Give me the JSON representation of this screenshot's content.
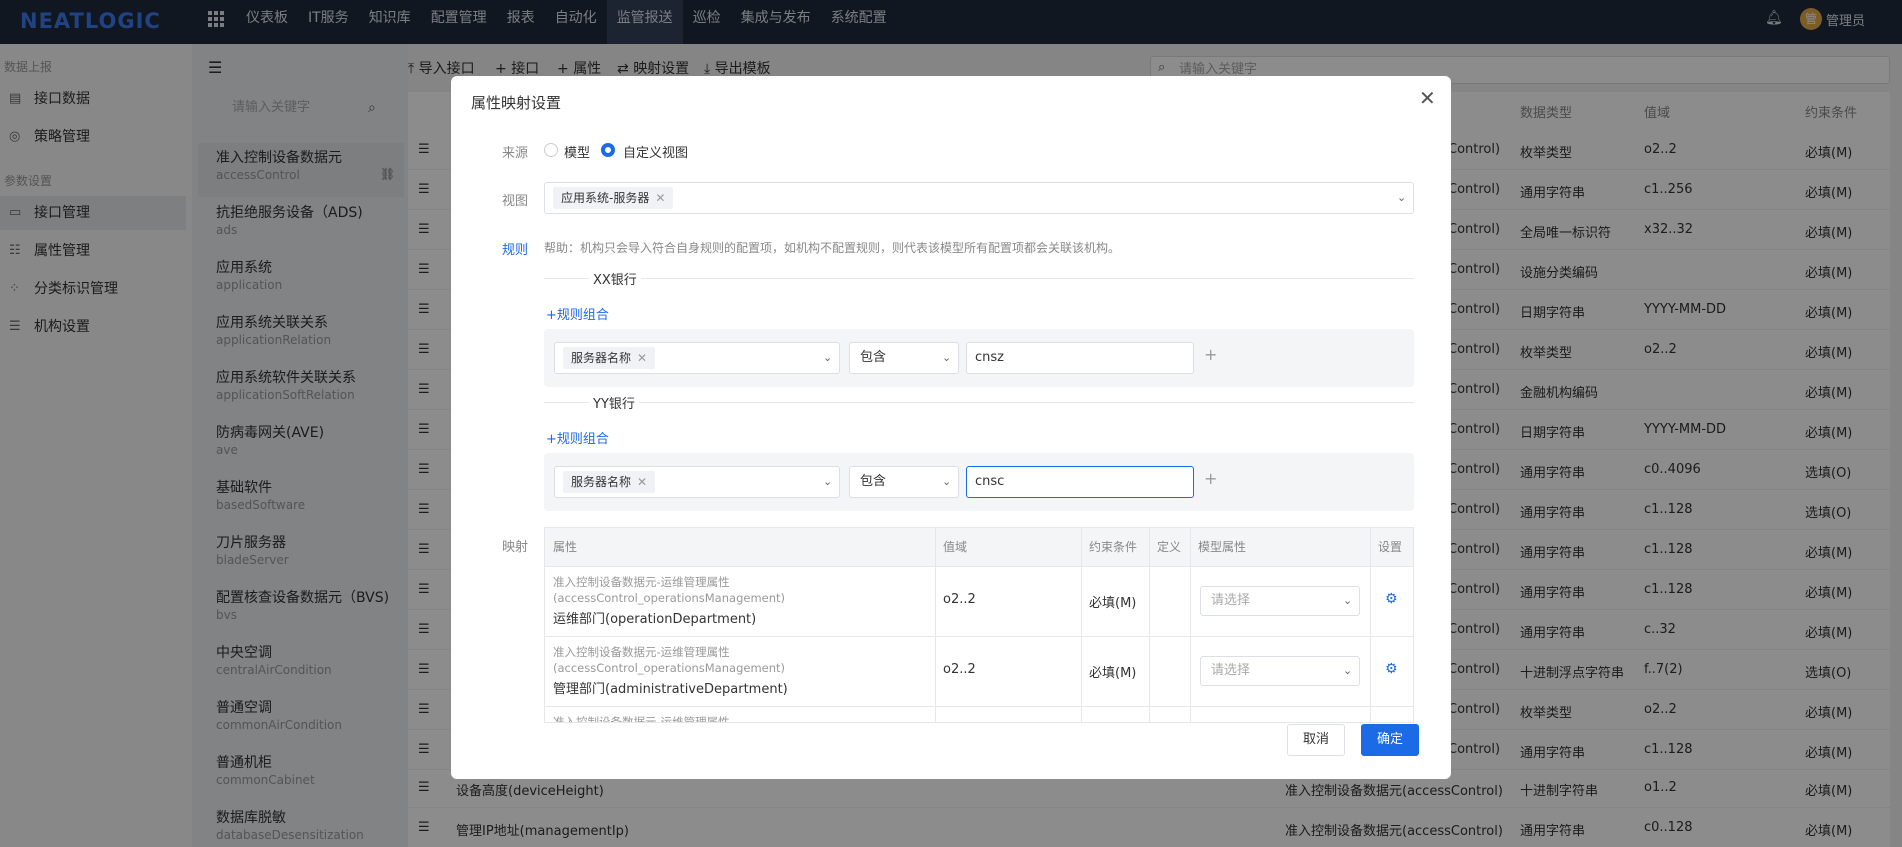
{
  "topbar": {
    "logo": "NEATLOGIC",
    "nav": [
      "仪表板",
      "IT服务",
      "知识库",
      "配置管理",
      "报表",
      "自动化",
      "监管报送",
      "巡检",
      "集成与发布",
      "系统配置"
    ],
    "active_nav": "监管报送",
    "avatar_text": "管",
    "user": "管理员",
    "bell_icon": "bell-icon"
  },
  "sidebar": {
    "section1": "数据上报",
    "section2": "参数设置",
    "items": [
      {
        "label": "接口数据",
        "icon": "data-icon"
      },
      {
        "label": "策略管理",
        "icon": "policy-icon"
      },
      {
        "label": "接口管理",
        "icon": "interface-icon"
      },
      {
        "label": "属性管理",
        "icon": "attribute-icon"
      },
      {
        "label": "分类标识管理",
        "icon": "category-icon"
      },
      {
        "label": "机构设置",
        "icon": "org-icon"
      }
    ]
  },
  "list": {
    "search_placeholder": "请输入关键字",
    "items": [
      {
        "title": "准入控制设备数据元",
        "sub": "accessControl"
      },
      {
        "title": "抗拒绝服务设备（ADS)",
        "sub": "ads"
      },
      {
        "title": "应用系统",
        "sub": "application"
      },
      {
        "title": "应用系统关联关系",
        "sub": "applicationRelation"
      },
      {
        "title": "应用系统软件关联关系",
        "sub": "applicationSoftRelation"
      },
      {
        "title": "防病毒网关(AVE)",
        "sub": "ave"
      },
      {
        "title": "基础软件",
        "sub": "basedSoftware"
      },
      {
        "title": "刀片服务器",
        "sub": "bladeServer"
      },
      {
        "title": "配置核查设备数据元（BVS)",
        "sub": "bvs"
      },
      {
        "title": "中央空调",
        "sub": "centralAirCondition"
      },
      {
        "title": "普通空调",
        "sub": "commonAirCondition"
      },
      {
        "title": "普通机柜",
        "sub": "commonCabinet"
      },
      {
        "title": "数据库脱敏",
        "sub": "databaseDesensitization"
      }
    ]
  },
  "toolbar": {
    "import_interface": "导入接口",
    "interface": "接口",
    "attribute": "属性",
    "mapping": "映射设置",
    "export_template": "导出模板",
    "search_placeholder": "请输入关键字"
  },
  "bg_table": {
    "headers": {
      "type": "数据类型",
      "domain": "值域",
      "constraint": "约束条件"
    },
    "rows": [
      {
        "src": "Control)",
        "type": "枚举类型",
        "domain": "o2..2",
        "constraint": "必填(M)"
      },
      {
        "src": "Control)",
        "type": "通用字符串",
        "domain": "c1..256",
        "constraint": "必填(M)"
      },
      {
        "src": "Control)",
        "type": "全局唯一标识符",
        "domain": "x32..32",
        "constraint": "必填(M)"
      },
      {
        "src": "Control)",
        "type": "设施分类编码",
        "domain": "",
        "constraint": "必填(M)"
      },
      {
        "src": "Control)",
        "type": "日期字符串",
        "domain": "YYYY-MM-DD",
        "constraint": "必填(M)"
      },
      {
        "src": "Control)",
        "type": "枚举类型",
        "domain": "o2..2",
        "constraint": "必填(M)"
      },
      {
        "src": "Control)",
        "type": "金融机构编码",
        "domain": "",
        "constraint": "必填(M)"
      },
      {
        "src": "Control)",
        "type": "日期字符串",
        "domain": "YYYY-MM-DD",
        "constraint": "必填(M)"
      },
      {
        "src": "Control)",
        "type": "通用字符串",
        "domain": "c0..4096",
        "constraint": "选填(O)"
      },
      {
        "src": "Control)",
        "type": "通用字符串",
        "domain": "c1..128",
        "constraint": "选填(O)"
      },
      {
        "src": "Control)",
        "type": "通用字符串",
        "domain": "c1..128",
        "constraint": "必填(M)"
      },
      {
        "src": "Control)",
        "type": "通用字符串",
        "domain": "c1..128",
        "constraint": "必填(M)"
      },
      {
        "src": "Control)",
        "type": "通用字符串",
        "domain": "c..32",
        "constraint": "必填(M)"
      },
      {
        "src": "Control)",
        "type": "十进制浮点字符串",
        "domain": "f..7(2)",
        "constraint": "选填(O)"
      },
      {
        "src": "Control)",
        "type": "枚举类型",
        "domain": "o2..2",
        "constraint": "必填(M)"
      },
      {
        "src": "Control)",
        "type": "通用字符串",
        "domain": "c1..128",
        "constraint": "必填(M)"
      },
      {
        "name": "设备高度(deviceHeight)",
        "src": "准入控制设备数据元(accessControl)",
        "type": "十进制字符串",
        "domain": "o1..2",
        "constraint": "必填(M)"
      },
      {
        "name": "管理IP地址(managementIp)",
        "src": "准入控制设备数据元(accessControl)",
        "type": "通用字符串",
        "domain": "c0..128",
        "constraint": "必填(M)"
      }
    ]
  },
  "dialog": {
    "title": "属性映射设置",
    "source_label": "来源",
    "source_options": [
      "模型",
      "自定义视图"
    ],
    "source_selected": "自定义视图",
    "view_label": "视图",
    "view_tag": "应用系统-服务器",
    "rule_label": "规则",
    "help": "帮助：机构只会导入符合自身规则的配置项，如机构不配置规则，则代表该模型所有配置项都会关联该机构。",
    "groups": [
      {
        "name": "XX银行",
        "add_label": "规则组合",
        "attr_tag": "服务器名称",
        "op": "包含",
        "value": "cnsz"
      },
      {
        "name": "YY银行",
        "add_label": "规则组合",
        "attr_tag": "服务器名称",
        "op": "包含",
        "value": "cnsc"
      }
    ],
    "mapping_label": "映射",
    "mapping_headers": [
      "属性",
      "值域",
      "约束条件",
      "定义",
      "模型属性",
      "设置"
    ],
    "mapping_rows": [
      {
        "path": "准入控制设备数据元-运维管理属性(accessControl_operationsManagement)",
        "attr": "运维部门(operationDepartment)",
        "domain": "o2..2",
        "constraint": "必填(M)",
        "placeholder": "请选择"
      },
      {
        "path": "准入控制设备数据元-运维管理属性(accessControl_operationsManagement)",
        "attr": "管理部门(administrativeDepartment)",
        "domain": "o2..2",
        "constraint": "必填(M)",
        "placeholder": "请选择"
      },
      {
        "path": "准入控制设备数据元-运维管理属性(accessControl_operationsManagement)",
        "attr": "",
        "domain": "",
        "constraint": "",
        "placeholder": ""
      }
    ],
    "cancel": "取消",
    "ok": "确定"
  }
}
